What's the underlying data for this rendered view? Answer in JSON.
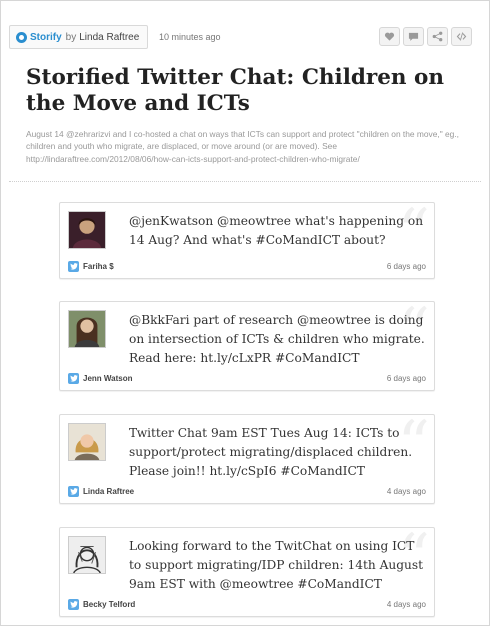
{
  "header": {
    "brand": "Storify",
    "by": "by",
    "author": "Linda Raftree",
    "posted": "10 minutes ago",
    "actions": [
      {
        "name": "like-icon"
      },
      {
        "name": "comment-icon"
      },
      {
        "name": "share-icon"
      },
      {
        "name": "embed-icon"
      }
    ]
  },
  "story": {
    "title": "Storified Twitter Chat: Children on the Move and ICTs",
    "description": "August 14 @zehrarizvi and I co-hosted a chat on ways that ICTs can support and protect \"children on the move,\" eg., children and youth who migrate, are displaced, or move around (or are moved). See http://lindaraftree.com/2012/08/06/how-can-icts-support-and-protect-children-who-migrate/"
  },
  "tweets": [
    {
      "text": "@jenKwatson @meowtree what's happening on 14 Aug? And what's #CoMandICT about?",
      "name": "Fariha $",
      "ago": "6 days ago",
      "avatar_icon": "user-avatar-icon"
    },
    {
      "text": "@BkkFari part of research @meowtree is doing on intersection of ICTs & children who migrate. Read here: ht.ly/cLxPR #CoMandICT",
      "name": "Jenn Watson",
      "ago": "6 days ago",
      "avatar_icon": "user-avatar-icon"
    },
    {
      "text": "Twitter Chat 9am EST Tues Aug 14: ICTs to support/protect migrating/displaced children. Please join!! ht.ly/cSpI6 #CoMandICT",
      "name": "Linda Raftree",
      "ago": "4 days ago",
      "avatar_icon": "user-avatar-icon"
    },
    {
      "text": "Looking forward to the TwitChat on using ICT to support migrating/IDP children: 14th August 9am EST with @meowtree #CoMandICT",
      "name": "Becky Telford",
      "ago": "4 days ago",
      "avatar_icon": "user-avatar-icon"
    }
  ]
}
